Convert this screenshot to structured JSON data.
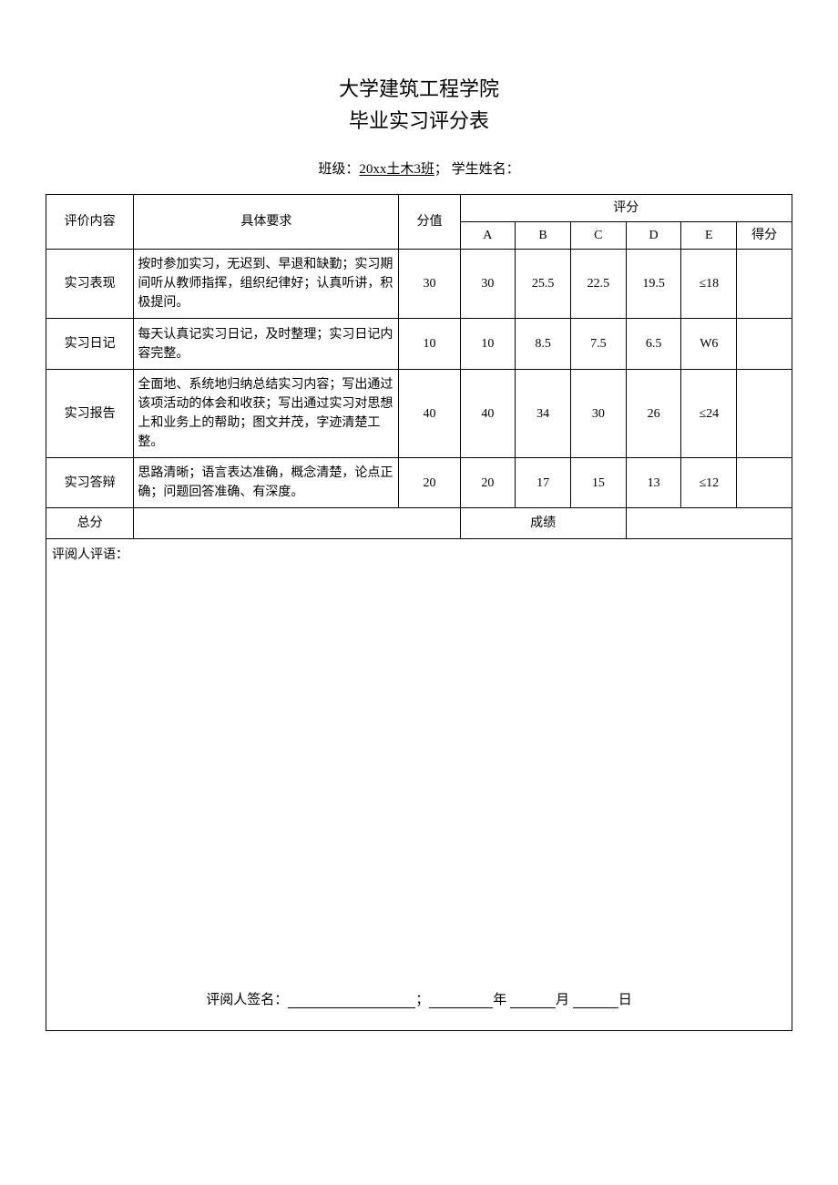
{
  "title1": "大学建筑工程学院",
  "title2": "毕业实习评分表",
  "class_label": "班级：",
  "class_value": "20xx土木3班",
  "separator": "；",
  "student_label": "学生姓名：",
  "headers": {
    "eval_content": "评价内容",
    "requirements": "具体要求",
    "score_value": "分值",
    "scoring": "评分",
    "grade_A": "A",
    "grade_B": "B",
    "grade_C": "C",
    "grade_D": "D",
    "grade_E": "E",
    "defen": "得分"
  },
  "rows": [
    {
      "name": "实习表现",
      "req": "按时参加实习，无迟到、早退和缺勤；实习期间听从教师指挥，组织纪律好；认真听讲，积极提问。",
      "score": "30",
      "A": "30",
      "B": "25.5",
      "C": "22.5",
      "D": "19.5",
      "E": "≤18"
    },
    {
      "name": "实习日记",
      "req": "每天认真记实习日记，及时整理；实习日记内容完整。",
      "score": "10",
      "A": "10",
      "B": "8.5",
      "C": "7.5",
      "D": "6.5",
      "E": "W6"
    },
    {
      "name": "实习报告",
      "req": "全面地、系统地归纳总结实习内容；写出通过该项活动的体会和收获；写出通过实习对思想上和业务上的帮助；图文并茂，字迹清楚工整。",
      "score": "40",
      "A": "40",
      "B": "34",
      "C": "30",
      "D": "26",
      "E": "≤24"
    },
    {
      "name": "实习答辩",
      "req": "思路清晰；语言表达准确，概念清楚，论点正确；问题回答准确、有深度。",
      "score": "20",
      "A": "20",
      "B": "17",
      "C": "15",
      "D": "13",
      "E": "≤12"
    }
  ],
  "total_label": "总分",
  "grade_label": "成绩",
  "comments_label": "评阅人评语：",
  "signature": {
    "prefix": "评阅人签名：",
    "year": "年",
    "month": "月",
    "day": "日"
  }
}
